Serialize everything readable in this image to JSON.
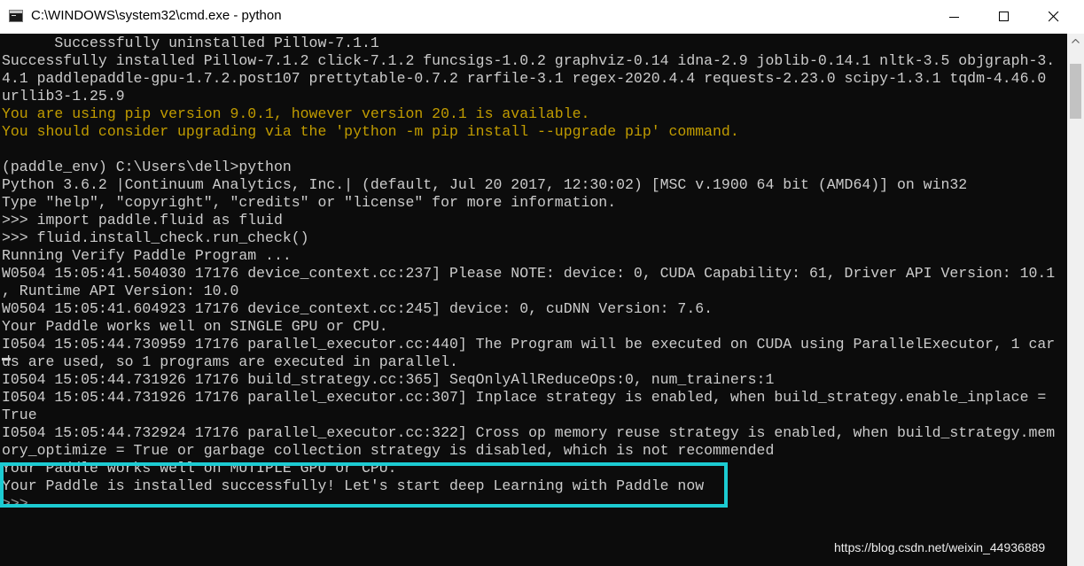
{
  "window": {
    "title": "C:\\WINDOWS\\system32\\cmd.exe - python",
    "icon": "cmd-icon",
    "controls": [
      "minimize-icon",
      "maximize-icon",
      "close-icon"
    ]
  },
  "console": {
    "lines": [
      {
        "text": "      Successfully uninstalled Pillow-7.1.1",
        "color": "#cccccc"
      },
      {
        "text": "Successfully installed Pillow-7.1.2 click-7.1.2 funcsigs-1.0.2 graphviz-0.14 idna-2.9 joblib-0.14.1 nltk-3.5 objgraph-3.",
        "color": "#cccccc"
      },
      {
        "text": "4.1 paddlepaddle-gpu-1.7.2.post107 prettytable-0.7.2 rarfile-3.1 regex-2020.4.4 requests-2.23.0 scipy-1.3.1 tqdm-4.46.0",
        "color": "#cccccc"
      },
      {
        "text": "urllib3-1.25.9",
        "color": "#cccccc"
      },
      {
        "text": "You are using pip version 9.0.1, however version 20.1 is available.",
        "color": "#c19c00"
      },
      {
        "text": "You should consider upgrading via the 'python -m pip install --upgrade pip' command.",
        "color": "#c19c00"
      },
      {
        "text": "",
        "color": "#cccccc"
      },
      {
        "text": "(paddle_env) C:\\Users\\dell>python",
        "color": "#cccccc"
      },
      {
        "text": "Python 3.6.2 |Continuum Analytics, Inc.| (default, Jul 20 2017, 12:30:02) [MSC v.1900 64 bit (AMD64)] on win32",
        "color": "#cccccc"
      },
      {
        "text": "Type \"help\", \"copyright\", \"credits\" or \"license\" for more information.",
        "color": "#cccccc"
      },
      {
        "text": ">>> import paddle.fluid as fluid",
        "color": "#cccccc"
      },
      {
        "text": ">>> fluid.install_check.run_check()",
        "color": "#cccccc"
      },
      {
        "text": "Running Verify Paddle Program ...",
        "color": "#cccccc"
      },
      {
        "text": "W0504 15:05:41.504030 17176 device_context.cc:237] Please NOTE: device: 0, CUDA Capability: 61, Driver API Version: 10.1",
        "color": "#cccccc"
      },
      {
        "text": ", Runtime API Version: 10.0",
        "color": "#cccccc"
      },
      {
        "text": "W0504 15:05:41.604923 17176 device_context.cc:245] device: 0, cuDNN Version: 7.6.",
        "color": "#cccccc"
      },
      {
        "text": "Your Paddle works well on SINGLE GPU or CPU.",
        "color": "#cccccc"
      },
      {
        "text": "I0504 15:05:44.730959 17176 parallel_executor.cc:440] The Program will be executed on CUDA using ParallelExecutor, 1 car",
        "color": "#cccccc"
      },
      {
        "text": "ds are used, so 1 programs are executed in parallel.",
        "color": "#cccccc"
      },
      {
        "text": "I0504 15:05:44.731926 17176 build_strategy.cc:365] SeqOnlyAllReduceOps:0, num_trainers:1",
        "color": "#cccccc"
      },
      {
        "text": "I0504 15:05:44.731926 17176 parallel_executor.cc:307] Inplace strategy is enabled, when build_strategy.enable_inplace =",
        "color": "#cccccc"
      },
      {
        "text": "True",
        "color": "#cccccc"
      },
      {
        "text": "I0504 15:05:44.732924 17176 parallel_executor.cc:322] Cross op memory reuse strategy is enabled, when build_strategy.mem",
        "color": "#cccccc"
      },
      {
        "text": "ory_optimize = True or garbage collection strategy is disabled, which is not recommended",
        "color": "#cccccc"
      },
      {
        "text": "Your Paddle works well on MUTIPLE GPU or CPU.",
        "color": "#cccccc"
      },
      {
        "text": "Your Paddle is installed successfully! Let's start deep Learning with Paddle now",
        "color": "#cccccc"
      },
      {
        "text": ">>>",
        "color": "#9a9a9a"
      }
    ]
  },
  "annotation": {
    "highlight_color": "#1ccbd2"
  },
  "watermark": {
    "text": "https://blog.csdn.net/weixin_44936889"
  }
}
